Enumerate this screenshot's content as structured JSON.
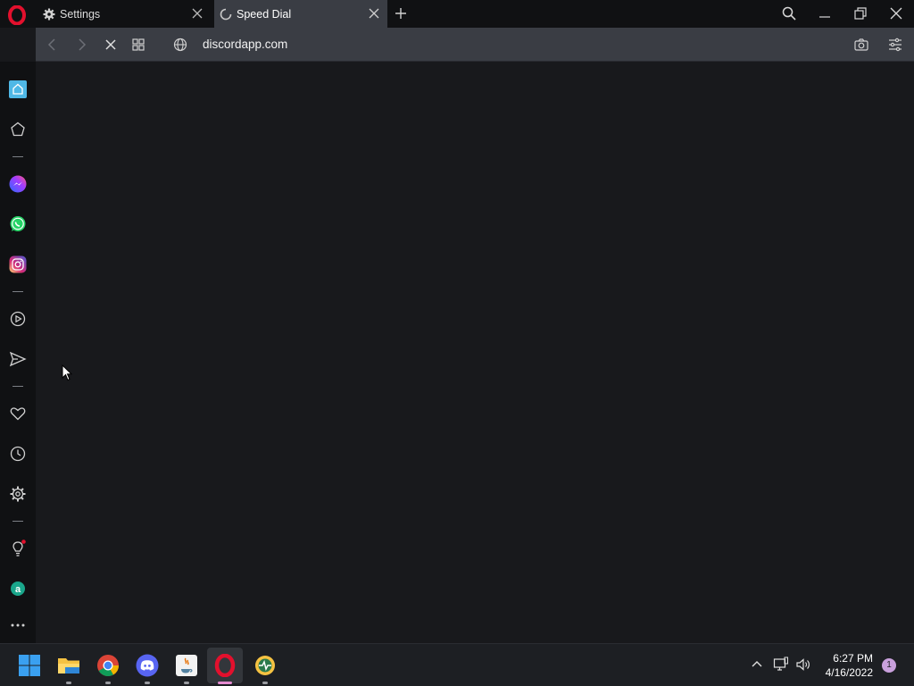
{
  "tabs": [
    {
      "label": "Settings",
      "icon": "gear-icon"
    },
    {
      "label": "Speed Dial",
      "icon": "loading-spinner-icon",
      "active": true
    }
  ],
  "address_bar": {
    "url": "discordapp.com"
  },
  "sidebar": {
    "items": [
      "home-icon",
      "bookmarks-icon",
      "messenger-icon",
      "whatsapp-icon",
      "instagram-icon",
      "player-icon",
      "send-icon",
      "my-flow-icon",
      "history-icon",
      "settings-icon",
      "whats-new-icon",
      "extension-icon",
      "more-icon"
    ]
  },
  "taskbar": {
    "apps": [
      "windows-start-icon",
      "file-explorer-icon",
      "chrome-icon",
      "discord-icon",
      "java-icon",
      "opera-icon",
      "pc-health-icon"
    ]
  },
  "clock": {
    "time": "6:27 PM",
    "date": "4/16/2022"
  },
  "notifications": {
    "count": "1"
  },
  "colors": {
    "accent": "#4fb8e6",
    "opera_red": "#e3102d",
    "chrome_bg": "#101113",
    "toolbar_bg": "#3a3d44",
    "page_bg": "#18191c"
  }
}
